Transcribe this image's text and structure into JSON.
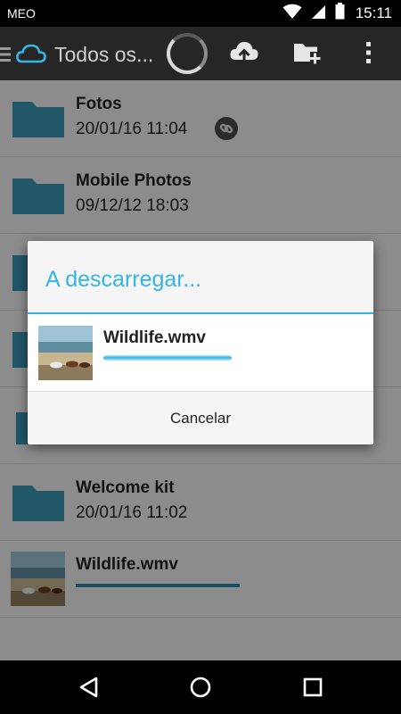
{
  "status_bar": {
    "carrier": "MEO",
    "time": "15:11",
    "icons": [
      "wifi-icon",
      "signal-icon",
      "battery-icon"
    ]
  },
  "app_bar": {
    "title": "Todos os...",
    "actions": [
      "upload-icon",
      "new-folder-icon",
      "overflow-menu-icon"
    ]
  },
  "files": [
    {
      "name": "Fotos",
      "date": "20/01/16 11:04",
      "type": "folder",
      "shared": true
    },
    {
      "name": "Mobile Photos",
      "date": "09/12/12 18:03",
      "type": "folder",
      "shared": false
    },
    {
      "name": "Welcome kit",
      "date": "20/01/16 11:02",
      "type": "folder",
      "shared": false
    },
    {
      "name": "Wildlife.wmv",
      "type": "video",
      "progress": 0.67
    }
  ],
  "dialog": {
    "title": "A descarregar...",
    "file_name": "Wildlife.wmv",
    "progress": 0.95,
    "cancel_label": "Cancelar"
  },
  "nav_bar": {
    "buttons": [
      "back-icon",
      "home-icon",
      "recents-icon"
    ]
  },
  "colors": {
    "accent": "#33b5e5",
    "folder": "#3a97b5",
    "app_bar": "#262626",
    "list_background": "#f2f2f2"
  }
}
